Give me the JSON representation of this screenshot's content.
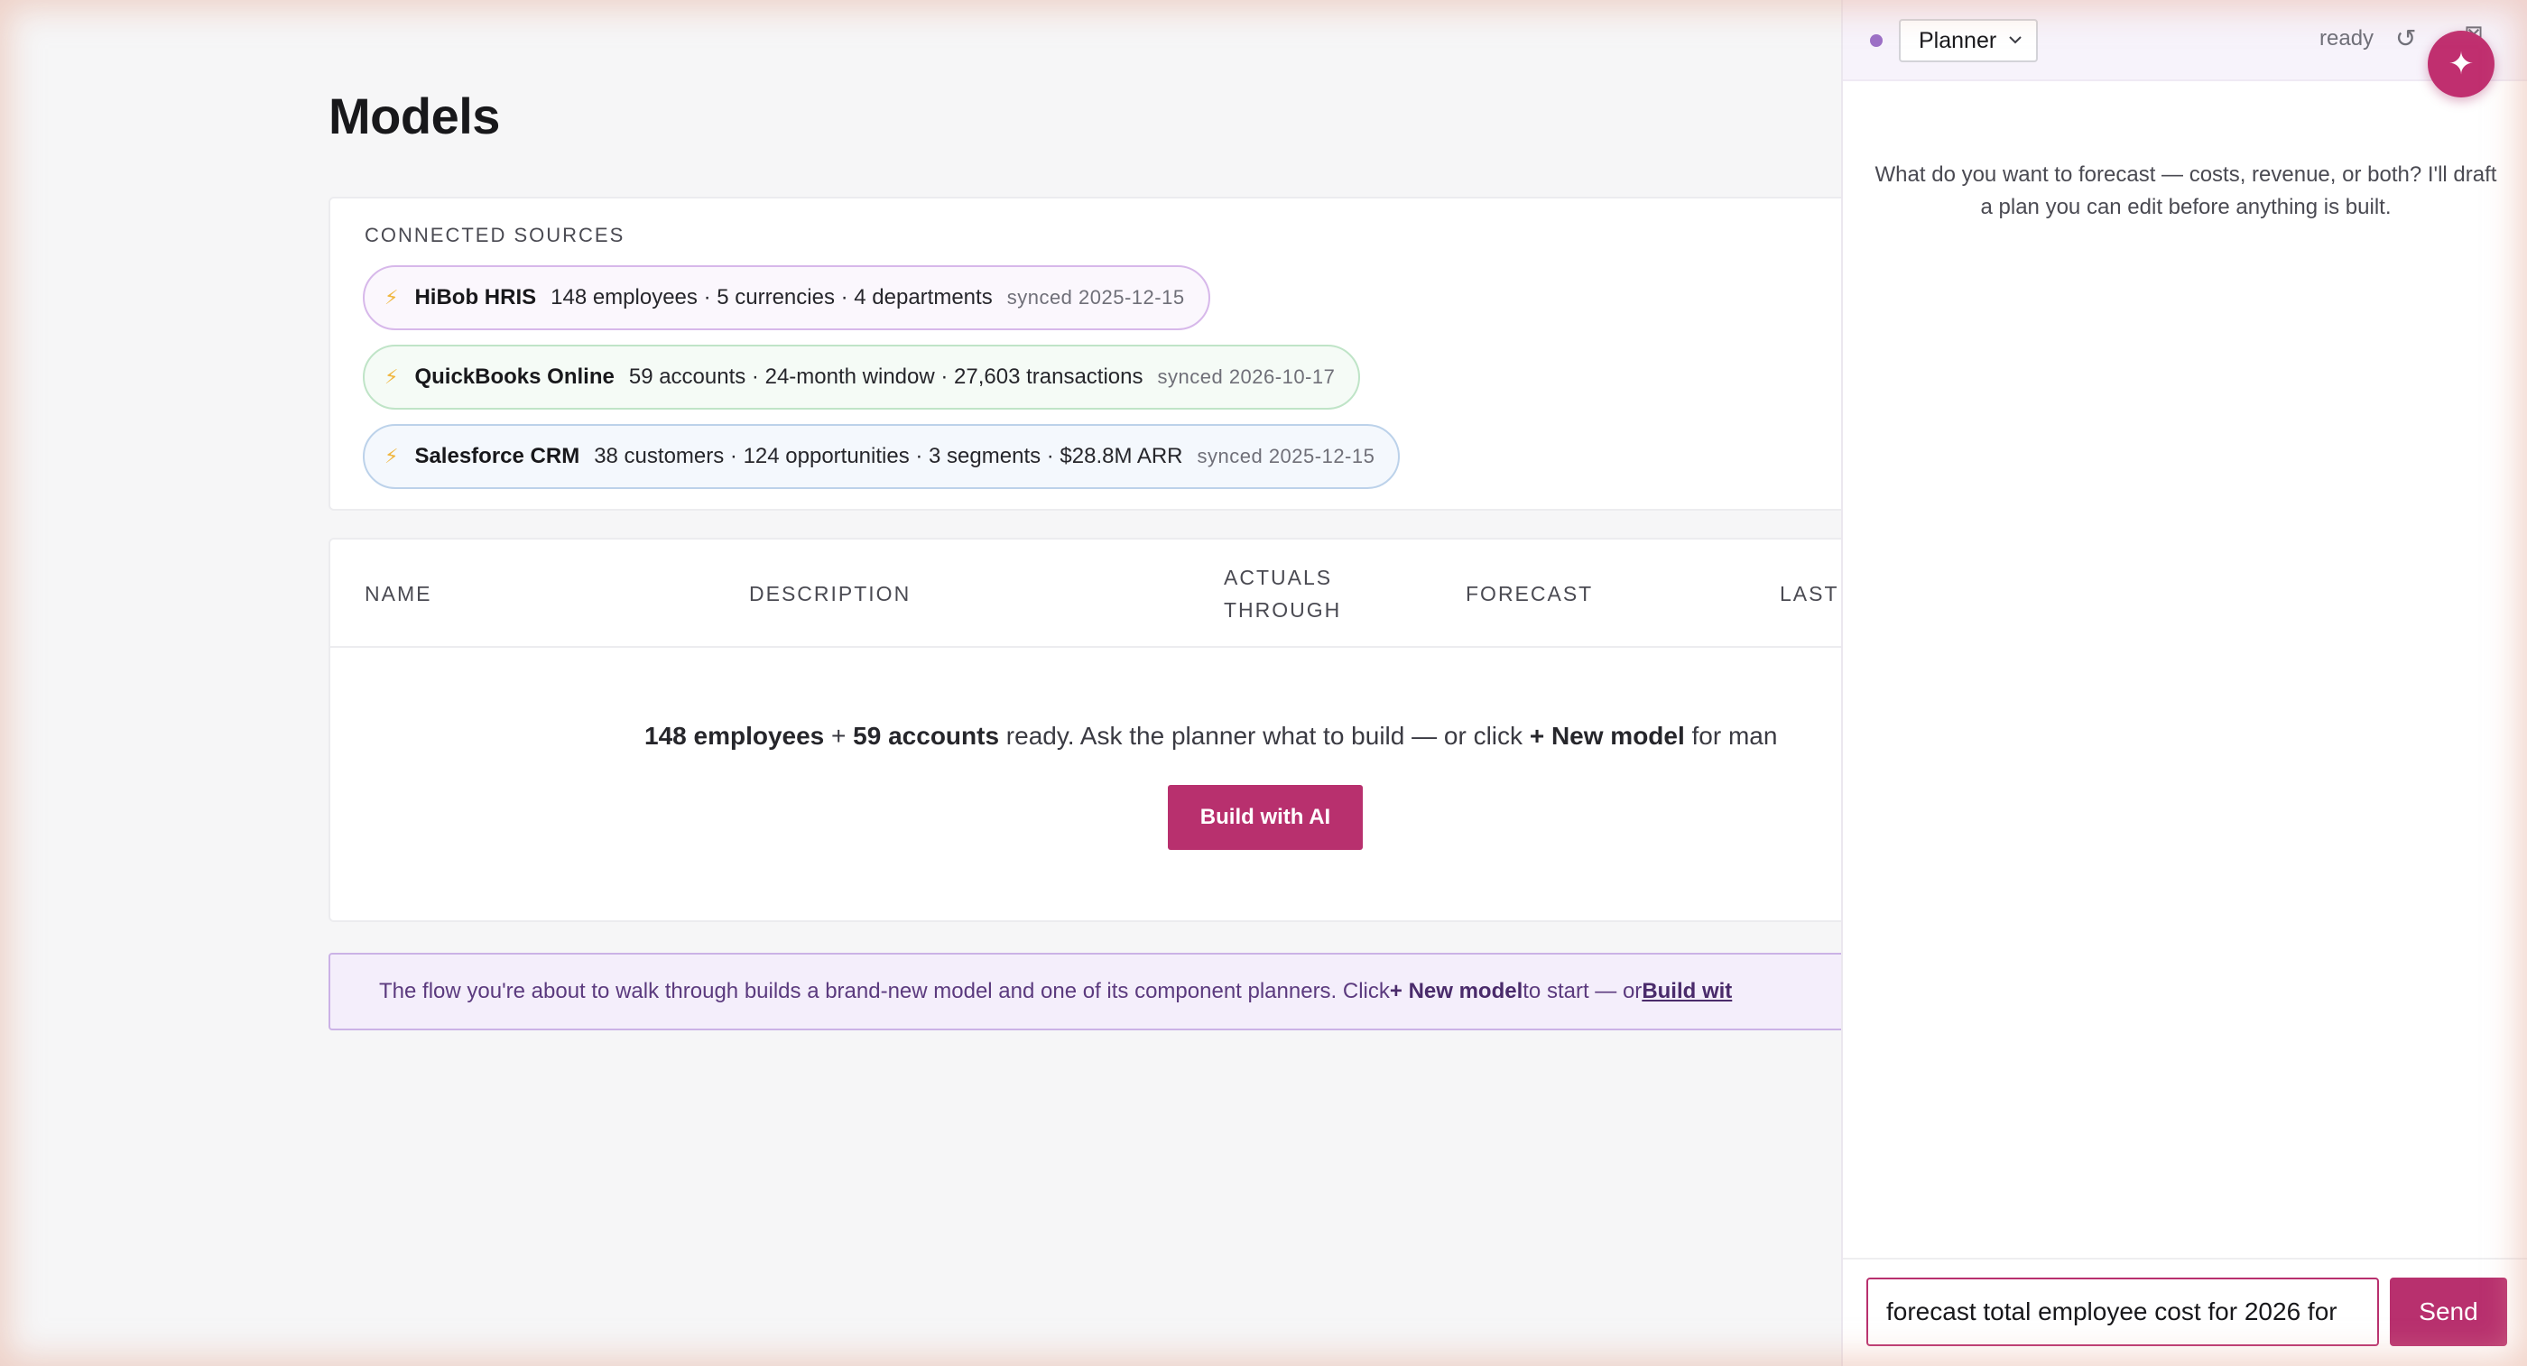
{
  "page": {
    "title": "Models"
  },
  "sources": {
    "heading": "CONNECTED SOURCES",
    "items": [
      {
        "name": "HiBob HRIS",
        "stats": "148 employees · 5 currencies · 4 departments",
        "synced": "synced 2025-12-15",
        "icon": "bolt-icon"
      },
      {
        "name": "QuickBooks Online",
        "stats": "59 accounts · 24-month window · 27,603 transactions",
        "synced": "synced 2026-10-17",
        "icon": "bolt-icon"
      },
      {
        "name": "Salesforce CRM",
        "stats": "38 customers · 124 opportunities · 3 segments · $28.8M ARR",
        "synced": "synced 2025-12-15",
        "icon": "bolt-icon"
      }
    ]
  },
  "table": {
    "columns": [
      "NAME",
      "DESCRIPTION",
      "ACTUALS THROUGH",
      "FORECAST",
      "LAST"
    ],
    "empty": {
      "employees": "148 employees",
      "plus": " + ",
      "accounts": "59 accounts",
      "middle": " ready. Ask the planner what to build — or click ",
      "new_model": "+ New model",
      "tail": " for man"
    },
    "build_button": "Build with AI"
  },
  "banner": {
    "text": "The flow you're about to walk through builds a brand-new model and one of its component planners. Click ",
    "new_model": "+ New model",
    "middle": " to start — or ",
    "link": "Build wit"
  },
  "panel": {
    "mode_select": "Planner",
    "status": "ready",
    "refresh_icon": "refresh-icon",
    "close_icon": "close-icon",
    "fab_icon": "sparkle-icon",
    "intro": "What do you want to forecast — costs, revenue, or both? I'll draft a plan you can edit before anything is built.",
    "input_value": "forecast total employee cost for 2026 for",
    "send": "Send"
  },
  "colors": {
    "accent": "#b8306e",
    "banner_bg": "#f4eefb",
    "status_dot": "#9c6fc6"
  }
}
